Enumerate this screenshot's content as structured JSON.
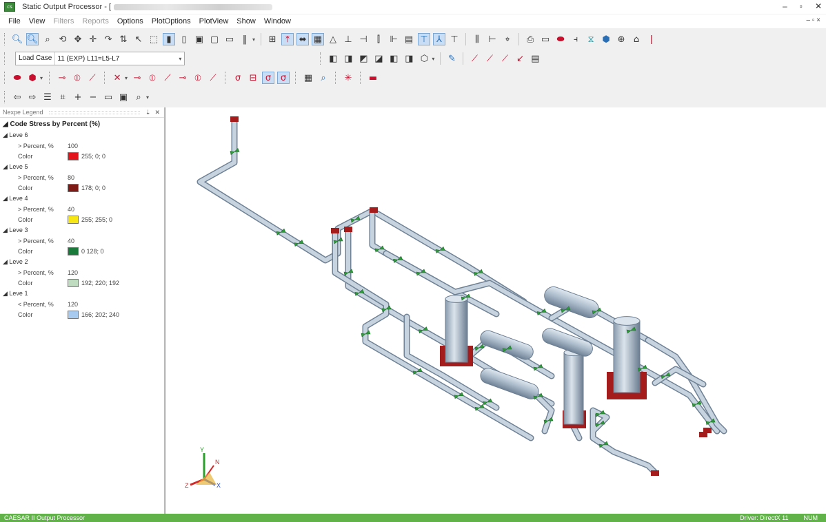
{
  "window": {
    "app_icon_text": "cs",
    "title": "Static Output Processor - [",
    "min_glyph": "–",
    "max_glyph": "▫",
    "close_glyph": "✕"
  },
  "menu": {
    "items": [
      {
        "label": "File",
        "enabled": true
      },
      {
        "label": "View",
        "enabled": true
      },
      {
        "label": "Filters",
        "enabled": false
      },
      {
        "label": "Reports",
        "enabled": false
      },
      {
        "label": "Options",
        "enabled": true
      },
      {
        "label": "PlotOptions",
        "enabled": true
      },
      {
        "label": "PlotView",
        "enabled": true
      },
      {
        "label": "Show",
        "enabled": true
      },
      {
        "label": "Window",
        "enabled": true
      }
    ],
    "right_controls": "– ▫ ×"
  },
  "toolbar": {
    "load_case_label": "Load Case",
    "load_case_value": "11 (EXP) L11=L5-L7"
  },
  "legend": {
    "panel_title": "Nexpe Legend",
    "pin_glyph": "⇣",
    "close_glyph": "✕",
    "title": "Code Stress by Percent (%)",
    "levels": [
      {
        "name": "Leve 6",
        "op_label": "> Percent, %",
        "percent": "100",
        "color_label": "Color",
        "color": "#e3141b",
        "color_text": "255; 0; 0"
      },
      {
        "name": "Leve 5",
        "op_label": "> Percent, %",
        "percent": "80",
        "color_label": "Color",
        "color": "#7e1b17",
        "color_text": "178; 0; 0"
      },
      {
        "name": "Leve 4",
        "op_label": "> Percent, %",
        "percent": "40",
        "color_label": "Color",
        "color": "#f5e614",
        "color_text": "255; 255; 0"
      },
      {
        "name": "Leve 3",
        "op_label": "> Percent, %",
        "percent": "40",
        "color_label": "Color",
        "color": "#1a7a3c",
        "color_text": "0 128; 0"
      },
      {
        "name": "Leve 2",
        "op_label": "> Percent, %",
        "percent": "120",
        "color_label": "Color",
        "color": "#c0dcc0",
        "color_text": "192; 220; 192"
      },
      {
        "name": "Leve 1",
        "op_label": "< Percent, %",
        "percent": "120",
        "color_label": "Color",
        "color": "#a6caf0",
        "color_text": "166; 202; 240"
      }
    ]
  },
  "axes": {
    "x": "X",
    "y": "Y",
    "z": "Z",
    "n": "N"
  },
  "status": {
    "left": "CAESAR II Output Processor",
    "driver": "Driver: DirectX 11",
    "mode": "NUM"
  },
  "colors": {
    "accent": "#62b24a",
    "pipe": "#b8c6d4",
    "equipment_base": "#a51c1c"
  },
  "icons": {
    "tb_row1": [
      "zoom-icon",
      "zoom-window-icon",
      "zoom-extents-icon",
      "orbit-icon",
      "pan-icon",
      "move-icon",
      "rotate-icon",
      "select-icon",
      "select-window-icon",
      "line-view-icon",
      "volume-view-icon",
      "translucent-icon",
      "wireframe-icon",
      "hidden-icon",
      "single-line-icon",
      "node-icon",
      "restraint-icon",
      "displacement-icon",
      "anchor-icon",
      "force-icon",
      "stress-icon",
      "reset-view-icon",
      "find-icon",
      "print-icon",
      "nozzle-icon",
      "flange-icon",
      "valve-icon",
      "pump-icon",
      "hanger-icon"
    ],
    "tb_row2": [
      "view-front-icon",
      "view-back-icon",
      "view-top-icon",
      "view-bottom-icon",
      "view-left-icon",
      "view-right-icon",
      "iso-view-icon",
      "paint-icon",
      "deformed-shape-icon",
      "animate-icon",
      "overlay-icon",
      "report-icon"
    ],
    "tb_row3": [
      "show-restraints-icon",
      "show-hangers-icon",
      "force-vector-icon",
      "moment-vector-icon",
      "stress-plot-icon",
      "translation-icon",
      "rotation-icon",
      "range-icon",
      "max-stress-icon",
      "grid-icon",
      "magnify-icon",
      "spin-icon",
      "legend-icon"
    ],
    "tb_row4": [
      "back-icon",
      "forward-icon",
      "list-icon",
      "binoculars-icon",
      "plus-icon",
      "minus-icon",
      "save-icon",
      "save-image-icon",
      "zoom-fit-icon"
    ]
  }
}
